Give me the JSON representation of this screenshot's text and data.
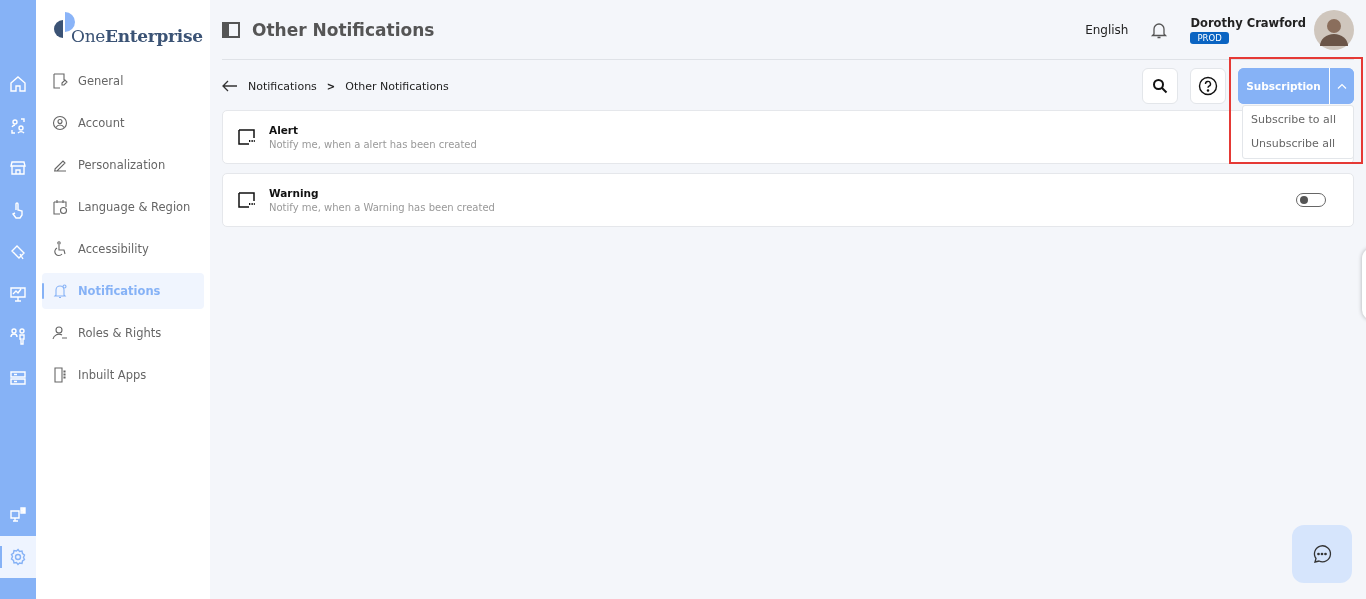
{
  "rail": {
    "top": [
      {
        "selected": false
      },
      {
        "selected": false
      },
      {
        "selected": false
      },
      {
        "selected": false
      },
      {
        "selected": false
      },
      {
        "selected": false
      },
      {
        "selected": false
      },
      {
        "selected": false
      }
    ],
    "bottom": [
      {
        "selected": false
      },
      {
        "selected": true
      }
    ]
  },
  "logo": {
    "light": "One",
    "bold": "Enterprise"
  },
  "sidebar": {
    "items": [
      {
        "label": "General",
        "selected": false
      },
      {
        "label": "Account",
        "selected": false
      },
      {
        "label": "Personalization",
        "selected": false
      },
      {
        "label": "Language & Region",
        "selected": false
      },
      {
        "label": "Accessibility",
        "selected": false
      },
      {
        "label": "Notifications",
        "selected": true
      },
      {
        "label": "Roles & Rights",
        "selected": false
      },
      {
        "label": "Inbuilt Apps",
        "selected": false
      }
    ]
  },
  "header": {
    "title": "Other Notifications",
    "language": "English",
    "user": {
      "name": "Dorothy Crawford",
      "badge": "PROD"
    }
  },
  "breadcrumb": [
    "Notifications",
    "Other Notifications"
  ],
  "breadcrumb_separator": ">",
  "subscription": {
    "label": "Subscription",
    "expanded": true,
    "menu": [
      "Subscribe to all",
      "Unsubscribe all"
    ]
  },
  "notifications": [
    {
      "title": "Alert",
      "description": "Notify me, when a alert has been created"
    },
    {
      "title": "Warning",
      "description": "Notify me, when a Warning has been created",
      "on": false
    }
  ]
}
